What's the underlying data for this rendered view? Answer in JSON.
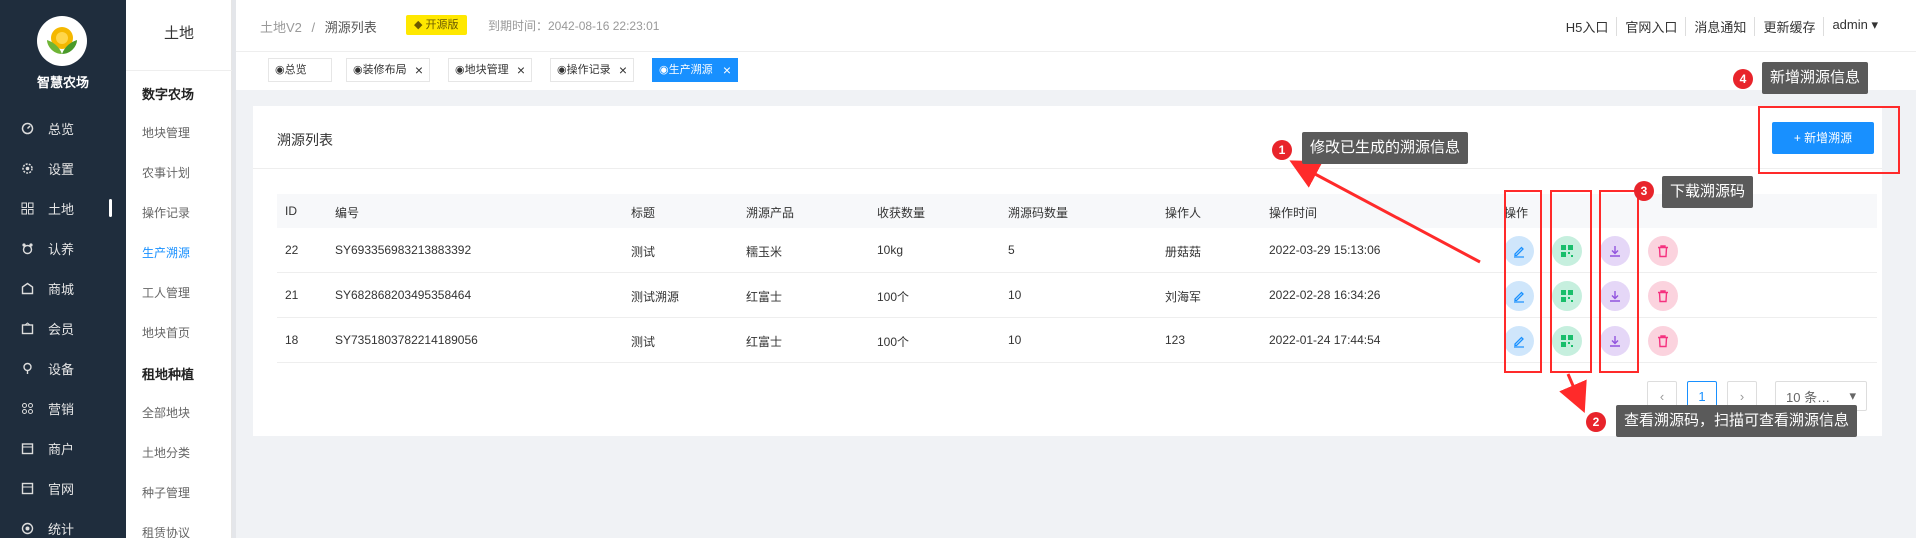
{
  "app": {
    "name": "智慧农场",
    "colors": {
      "accent": "#1890ff",
      "sidebar_bg": "#1f2d3d",
      "annotation_red": "#ff2a2a",
      "badge_yellow": "#ffe800"
    }
  },
  "sidebar": {
    "items": [
      {
        "label": "总览",
        "icon": "dashboard-icon"
      },
      {
        "label": "设置",
        "icon": "gear-icon"
      },
      {
        "label": "土地",
        "icon": "grid-icon"
      },
      {
        "label": "认养",
        "icon": "adopt-icon"
      },
      {
        "label": "商城",
        "icon": "shop-icon"
      },
      {
        "label": "会员",
        "icon": "member-icon"
      },
      {
        "label": "设备",
        "icon": "device-icon"
      },
      {
        "label": "营销",
        "icon": "marketing-icon"
      },
      {
        "label": "商户",
        "icon": "merchant-icon"
      },
      {
        "label": "官网",
        "icon": "website-icon"
      },
      {
        "label": "统计",
        "icon": "stats-icon"
      }
    ]
  },
  "submenu": {
    "title": "土地",
    "groups": [
      {
        "label": "数字农场",
        "items": [
          "地块管理",
          "农事计划",
          "操作记录",
          "生产溯源",
          "工人管理",
          "地块首页"
        ]
      },
      {
        "label": "租地种植",
        "items": [
          "全部地块",
          "土地分类",
          "种子管理",
          "租赁协议"
        ]
      }
    ]
  },
  "header": {
    "breadcrumb_root": "土地V2",
    "breadcrumb_sep": "/",
    "breadcrumb_current": "溯源列表",
    "badge": "开源版",
    "expire": "到期时间：2042-08-16 22:23:01",
    "links": [
      "H5入口",
      "官网入口",
      "消息通知",
      "更新缓存",
      "admin ▾"
    ]
  },
  "tabs": [
    {
      "label": "◉总览"
    },
    {
      "label": "◉装修布局"
    },
    {
      "label": "◉地块管理"
    },
    {
      "label": "◉操作记录"
    },
    {
      "label": "◉生产溯源"
    }
  ],
  "card": {
    "title": "溯源列表",
    "add_button": "+ 新增溯源"
  },
  "table": {
    "columns": [
      "ID",
      "编号",
      "标题",
      "溯源产品",
      "收获数量",
      "溯源码数量",
      "操作人",
      "操作时间",
      "操作"
    ],
    "rows": [
      [
        "22",
        "SY693356983213883392",
        "测试",
        "糯玉米",
        "10kg",
        "5",
        "册菇菇",
        "2022-03-29 15:13:06"
      ],
      [
        "21",
        "SY682868203495358464",
        "测试溯源",
        "红富士",
        "100个",
        "10",
        "刘海军",
        "2022-02-28 16:34:26"
      ],
      [
        "18",
        "SY7351803782214189056",
        "测试",
        "红富士",
        "100个",
        "10",
        "123",
        "2022-01-24 17:44:54"
      ]
    ]
  },
  "pagination": {
    "prev": "‹",
    "current": "1",
    "next": "›",
    "page_size": "10 条…",
    "page_size_arrow": "▾"
  },
  "annotations": [
    {
      "num": "1",
      "text": "修改已生成的溯源信息"
    },
    {
      "num": "2",
      "text": "查看溯源码，扫描可查看溯源信息"
    },
    {
      "num": "3",
      "text": "下载溯源码"
    },
    {
      "num": "4",
      "text": "新增溯源信息"
    }
  ]
}
